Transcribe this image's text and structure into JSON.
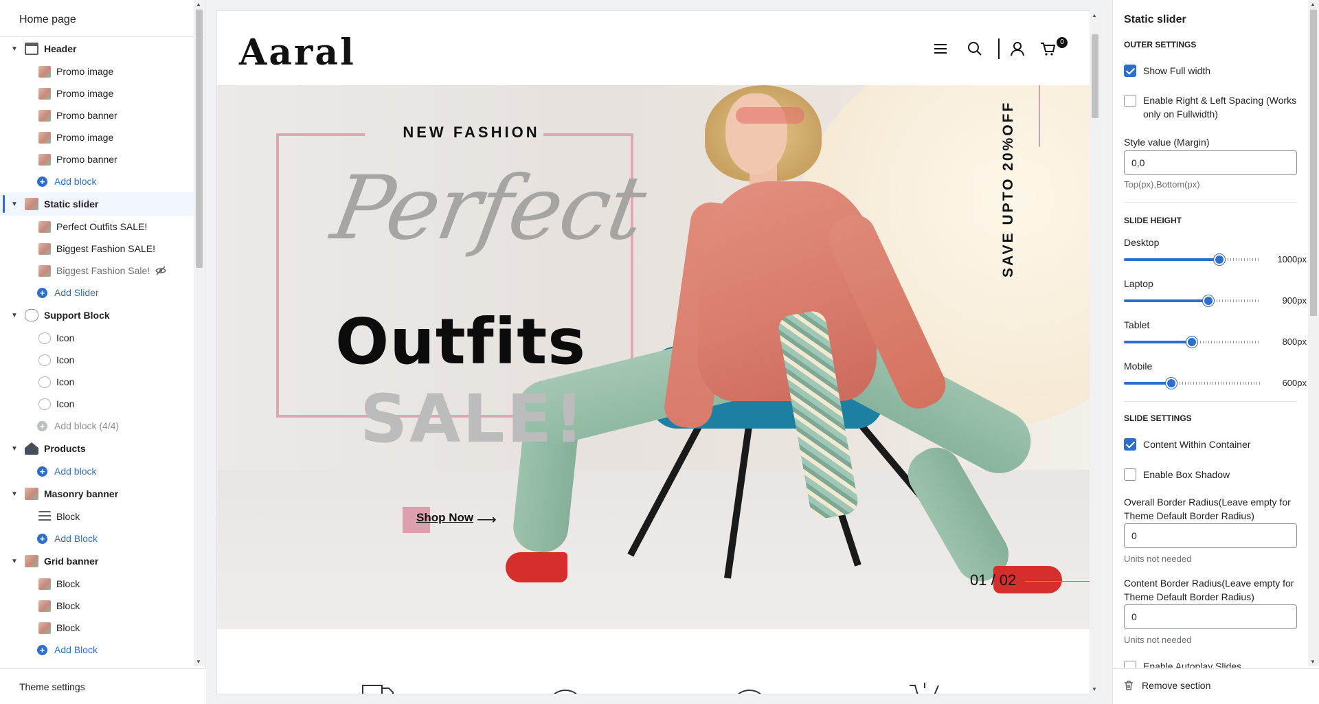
{
  "left": {
    "title": "Home page",
    "footer": "Theme settings",
    "tree": [
      {
        "type": "section",
        "label": "Header",
        "thumb": "t-header"
      },
      {
        "type": "child",
        "label": "Promo image",
        "thumb": "t-img"
      },
      {
        "type": "child",
        "label": "Promo image",
        "thumb": "t-img"
      },
      {
        "type": "child",
        "label": "Promo banner",
        "thumb": "t-img"
      },
      {
        "type": "child",
        "label": "Promo image",
        "thumb": "t-img"
      },
      {
        "type": "child",
        "label": "Promo banner",
        "thumb": "t-img"
      },
      {
        "type": "add",
        "label": "Add block"
      },
      {
        "type": "section",
        "label": "Static slider",
        "thumb": "t-img",
        "selected": true
      },
      {
        "type": "child",
        "label": "Perfect Outfits SALE!",
        "thumb": "t-img"
      },
      {
        "type": "child",
        "label": "Biggest Fashion SALE!",
        "thumb": "t-img"
      },
      {
        "type": "child",
        "label": "Biggest Fashion Sale!",
        "thumb": "t-img",
        "hidden": true
      },
      {
        "type": "add",
        "label": "Add Slider"
      },
      {
        "type": "section",
        "label": "Support Block",
        "thumb": "t-cloud"
      },
      {
        "type": "child",
        "label": "Icon",
        "thumb": "t-icon"
      },
      {
        "type": "child",
        "label": "Icon",
        "thumb": "t-icon"
      },
      {
        "type": "child",
        "label": "Icon",
        "thumb": "t-icon"
      },
      {
        "type": "child",
        "label": "Icon",
        "thumb": "t-icon"
      },
      {
        "type": "add",
        "label": "Add block (4/4)",
        "disabled": true
      },
      {
        "type": "section",
        "label": "Products",
        "thumb": "t-house"
      },
      {
        "type": "add",
        "label": "Add block"
      },
      {
        "type": "section",
        "label": "Masonry banner",
        "thumb": "t-img"
      },
      {
        "type": "child",
        "label": "Block",
        "thumb": "t-lines"
      },
      {
        "type": "add",
        "label": "Add Block"
      },
      {
        "type": "section",
        "label": "Grid banner",
        "thumb": "t-img"
      },
      {
        "type": "child",
        "label": "Block",
        "thumb": "t-img"
      },
      {
        "type": "child",
        "label": "Block",
        "thumb": "t-img"
      },
      {
        "type": "child",
        "label": "Block",
        "thumb": "t-img"
      },
      {
        "type": "add",
        "label": "Add Block"
      }
    ]
  },
  "preview": {
    "logo": "Aaral",
    "cart_count": "0",
    "hero": {
      "eyebrow": "NEW FASHION",
      "script": "Perfect",
      "main": "Outfits",
      "sale": "SALE!",
      "cta": "Shop Now",
      "side_text": "SAVE UPTO 20%OFF",
      "counter": "01 / 02"
    }
  },
  "right": {
    "title": "Static slider",
    "outer_settings": "OUTER SETTINGS",
    "show_full_width": "Show Full width",
    "enable_spacing": "Enable Right & Left Spacing (Works only on Fullwidth)",
    "style_value_label": "Style value (Margin)",
    "style_value": "0,0",
    "style_value_hint": "Top(px),Bottom(px)",
    "slide_height": "SLIDE HEIGHT",
    "sliders": [
      {
        "label": "Desktop",
        "value": "1000px",
        "level": 0.7
      },
      {
        "label": "Laptop",
        "value": "900px",
        "level": 0.62
      },
      {
        "label": "Tablet",
        "value": "800px",
        "level": 0.5
      },
      {
        "label": "Mobile",
        "value": "600px",
        "level": 0.35
      }
    ],
    "slide_settings": "SLIDE SETTINGS",
    "content_within_container": "Content Within Container",
    "enable_box_shadow": "Enable Box Shadow",
    "overall_radius_label": "Overall Border Radius(Leave empty for Theme Default Border Radius)",
    "overall_radius_value": "0",
    "overall_radius_hint": "Units not needed",
    "content_radius_label": "Content Border Radius(Leave empty for Theme Default Border Radius)",
    "content_radius_value": "0",
    "content_radius_hint": "Units not needed",
    "autoplay": "Enable Autoplay Slides",
    "remove_section": "Remove section"
  }
}
